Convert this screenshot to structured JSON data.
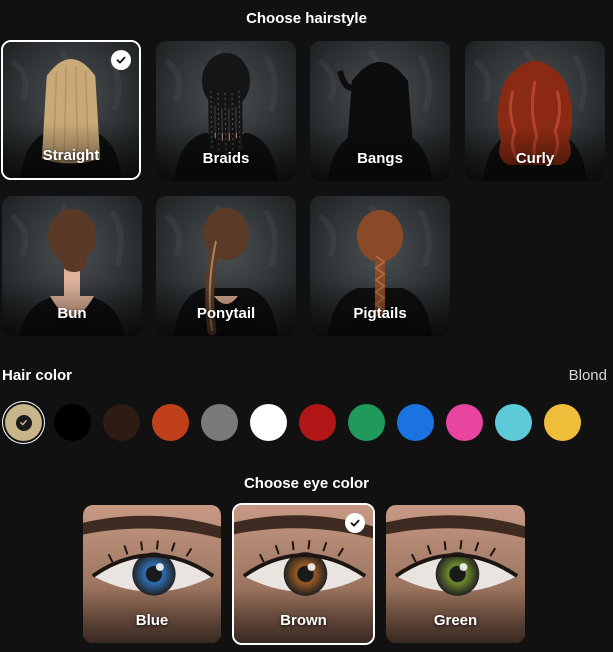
{
  "hairstyle_section": {
    "title": "Choose hairstyle",
    "options": [
      {
        "label": "Straight",
        "hair_color": "#c9a978",
        "selected": true
      },
      {
        "label": "Braids",
        "hair_color": "#151515",
        "selected": false
      },
      {
        "label": "Bangs",
        "hair_color": "#0d0d0d",
        "selected": false
      },
      {
        "label": "Curly",
        "hair_color": "#8a2a14",
        "selected": false
      },
      {
        "label": "Bun",
        "hair_color": "#5a3a26",
        "selected": false
      },
      {
        "label": "Ponytail",
        "hair_color": "#5b3b28",
        "selected": false
      },
      {
        "label": "Pigtails",
        "hair_color": "#8a4a2a",
        "selected": false
      }
    ]
  },
  "hair_color_section": {
    "label": "Hair color",
    "selected_value": "Blond",
    "swatches": [
      {
        "name": "blond",
        "color": "#c9b58a",
        "selected": true
      },
      {
        "name": "black",
        "color": "#000000",
        "selected": false
      },
      {
        "name": "dark-brown",
        "color": "#2e1c14",
        "selected": false
      },
      {
        "name": "auburn",
        "color": "#c0401c",
        "selected": false
      },
      {
        "name": "gray",
        "color": "#7a7a7a",
        "selected": false
      },
      {
        "name": "white",
        "color": "#ffffff",
        "selected": false
      },
      {
        "name": "red",
        "color": "#b31616",
        "selected": false
      },
      {
        "name": "green",
        "color": "#1f9a5c",
        "selected": false
      },
      {
        "name": "blue",
        "color": "#1a73e0",
        "selected": false
      },
      {
        "name": "pink",
        "color": "#e845a0",
        "selected": false
      },
      {
        "name": "cyan",
        "color": "#5ecad8",
        "selected": false
      },
      {
        "name": "yellow",
        "color": "#f0bd3a",
        "selected": false
      }
    ]
  },
  "eye_section": {
    "title": "Choose eye color",
    "options": [
      {
        "label": "Blue",
        "iris_color": "#2f6fb8",
        "selected": false
      },
      {
        "label": "Brown",
        "iris_color": "#9a5a22",
        "selected": true
      },
      {
        "label": "Green",
        "iris_color": "#6d8a2e",
        "selected": false
      }
    ]
  }
}
